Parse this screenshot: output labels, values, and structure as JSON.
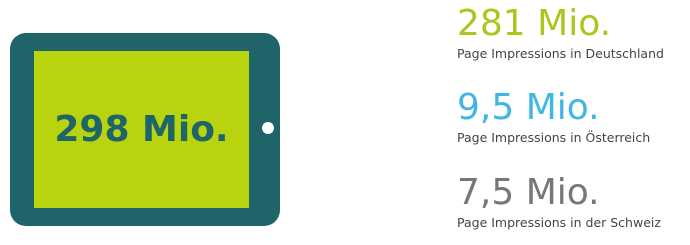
{
  "tablet": {
    "total": "298 Mio.",
    "frame_color": "#1e6468",
    "screen_color": "#b8d40f"
  },
  "stats": [
    {
      "value": "281 Mio.",
      "label": "Page Impressions in Deutschland",
      "color": "#a8c81e"
    },
    {
      "value": "9,5 Mio.",
      "label": "Page Impressions in Österreich",
      "color": "#3fb6e4"
    },
    {
      "value": "7,5 Mio.",
      "label": "Page Impressions in der Schweiz",
      "color": "#777777"
    }
  ]
}
